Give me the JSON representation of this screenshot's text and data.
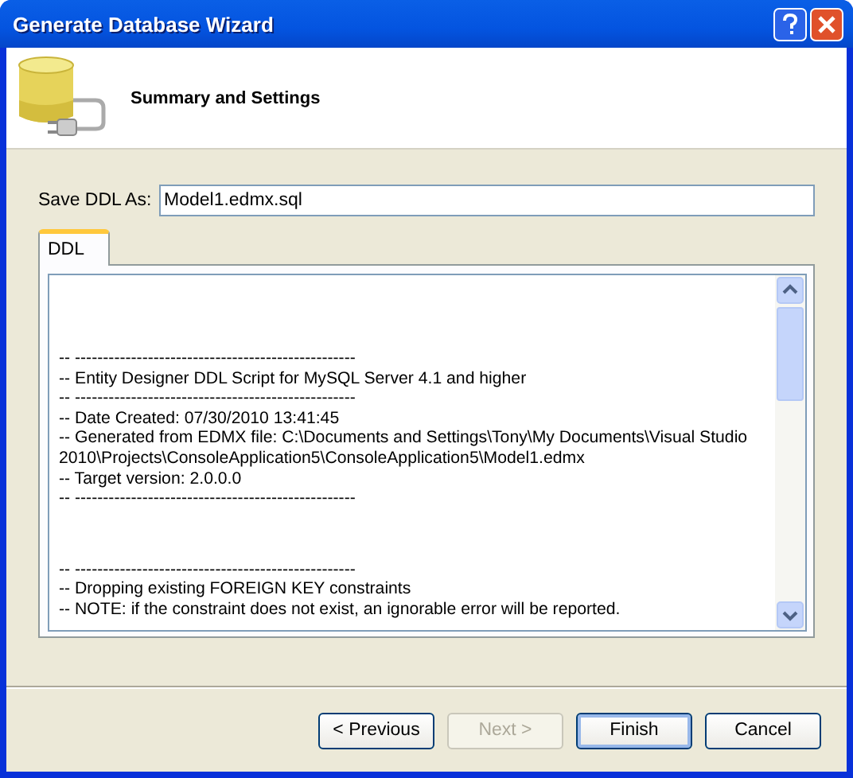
{
  "window": {
    "title": "Generate Database Wizard"
  },
  "header": {
    "title": "Summary and Settings"
  },
  "save_as": {
    "label": "Save DDL As:",
    "value": "Model1.edmx.sql"
  },
  "tabs": [
    {
      "label": "DDL",
      "selected": true
    }
  ],
  "ddl_blocks": [
    [
      "-- --------------------------------------------------",
      "-- Entity Designer DDL Script for MySQL Server 4.1 and higher",
      "-- --------------------------------------------------",
      "-- Date Created: 07/30/2010 13:41:45",
      "-- Generated from EDMX file: C:\\Documents and Settings\\Tony\\My Documents\\Visual Studio 2010\\Projects\\ConsoleApplication5\\ConsoleApplication5\\Model1.edmx",
      "-- Target version: 2.0.0.0",
      "-- --------------------------------------------------"
    ],
    [
      "-- --------------------------------------------------",
      "-- Dropping existing FOREIGN KEY constraints",
      "-- NOTE: if the constraint does not exist, an ignorable error will be reported."
    ]
  ],
  "buttons": [
    {
      "label": "< Previous",
      "disabled": false,
      "default": false
    },
    {
      "label": "Next >",
      "disabled": true,
      "default": false
    },
    {
      "label": "Finish",
      "disabled": false,
      "default": true
    },
    {
      "label": "Cancel",
      "disabled": false,
      "default": false
    }
  ]
}
